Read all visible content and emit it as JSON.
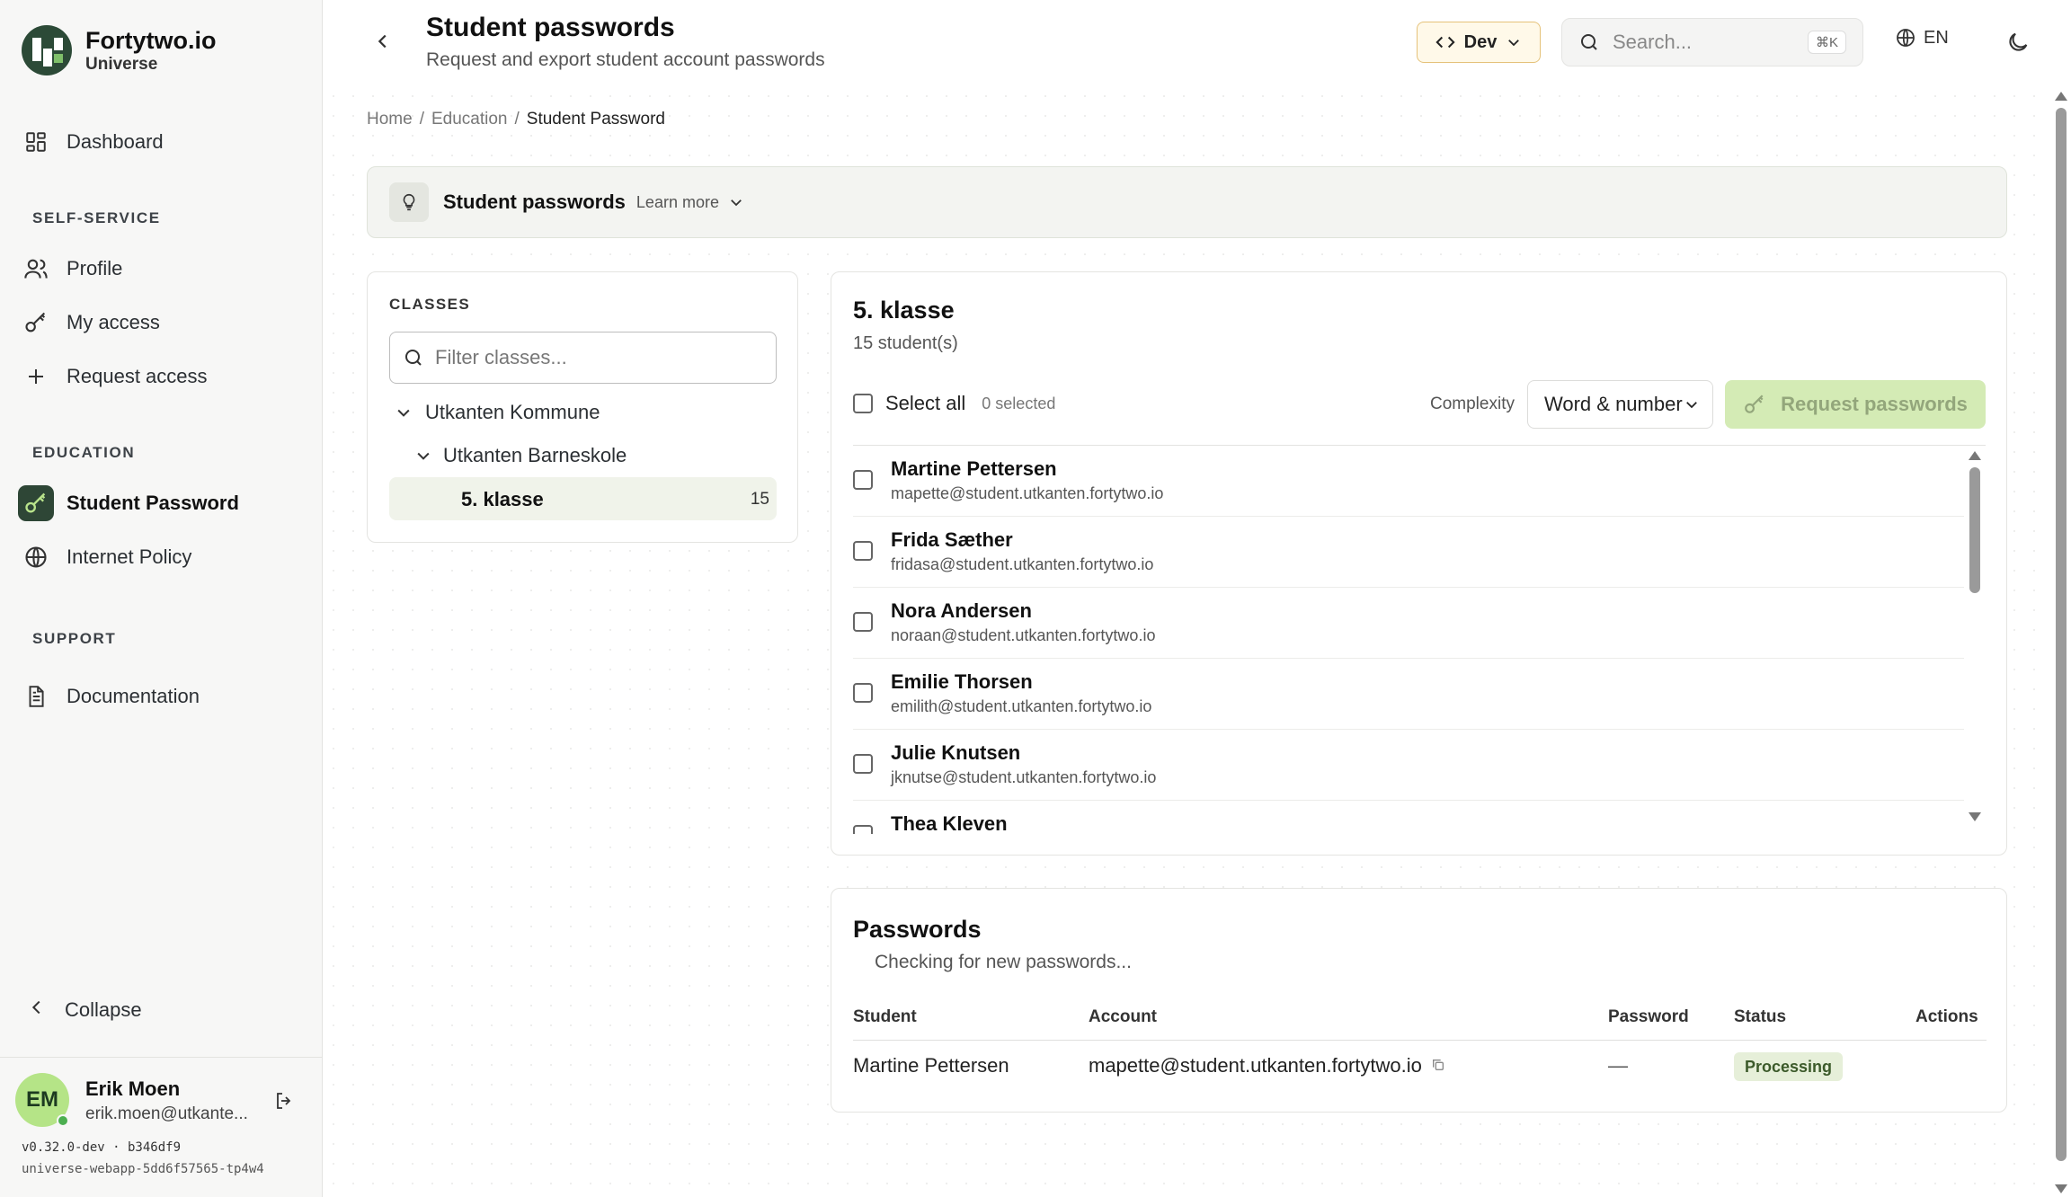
{
  "brand": {
    "title": "Fortytwo.io",
    "subtitle": "Universe"
  },
  "sidebar": {
    "dashboard": "Dashboard",
    "sections": {
      "self_service": "SELF-SERVICE",
      "education": "EDUCATION",
      "support": "SUPPORT"
    },
    "items": {
      "profile": "Profile",
      "my_access": "My access",
      "request_access": "Request access",
      "student_password": "Student Password",
      "internet_policy": "Internet Policy",
      "documentation": "Documentation"
    },
    "collapse": "Collapse",
    "user": {
      "initials": "EM",
      "name": "Erik Moen",
      "email": "erik.moen@utkante..."
    },
    "version": "v0.32.0-dev · b346df9",
    "pod": "universe-webapp-5dd6f57565-tp4w4"
  },
  "header": {
    "title": "Student passwords",
    "subtitle": "Request and export student account passwords",
    "env": "Dev",
    "search_placeholder": "Search...",
    "search_shortcut": "⌘K",
    "language": "EN"
  },
  "breadcrumb": [
    "Home",
    "Education",
    "Student Password"
  ],
  "banner": {
    "title": "Student passwords",
    "learn_more": "Learn more"
  },
  "classes": {
    "label": "CLASSES",
    "filter_placeholder": "Filter classes...",
    "tree": {
      "municipality": "Utkanten Kommune",
      "school": "Utkanten Barneskole",
      "class_name": "5. klasse",
      "class_count": "15"
    }
  },
  "class_panel": {
    "title": "5. klasse",
    "count": "15 student(s)",
    "select_all": "Select all",
    "selected": "0 selected",
    "complexity_label": "Complexity",
    "complexity_value": "Word & number",
    "request_button": "Request passwords",
    "students": [
      {
        "name": "Martine Pettersen",
        "email": "mapette@student.utkanten.fortytwo.io"
      },
      {
        "name": "Frida Sæther",
        "email": "fridasa@student.utkanten.fortytwo.io"
      },
      {
        "name": "Nora Andersen",
        "email": "noraan@student.utkanten.fortytwo.io"
      },
      {
        "name": "Emilie Thorsen",
        "email": "emilith@student.utkanten.fortytwo.io"
      },
      {
        "name": "Julie Knutsen",
        "email": "jknutse@student.utkanten.fortytwo.io"
      },
      {
        "name": "Thea Kleven",
        "email": ""
      }
    ]
  },
  "passwords": {
    "title": "Passwords",
    "status": "Checking for new passwords...",
    "columns": [
      "Student",
      "Account",
      "Password",
      "Status",
      "Actions"
    ],
    "rows": [
      {
        "student": "Martine Pettersen",
        "account": "mapette@student.utkanten.fortytwo.io",
        "password": "—",
        "status": "Processing"
      }
    ]
  },
  "colors": {
    "accent_dark": "#2e4636",
    "accent_light": "#d4ebb5",
    "avatar": "#b5e487",
    "env_border": "#e5c27a"
  }
}
